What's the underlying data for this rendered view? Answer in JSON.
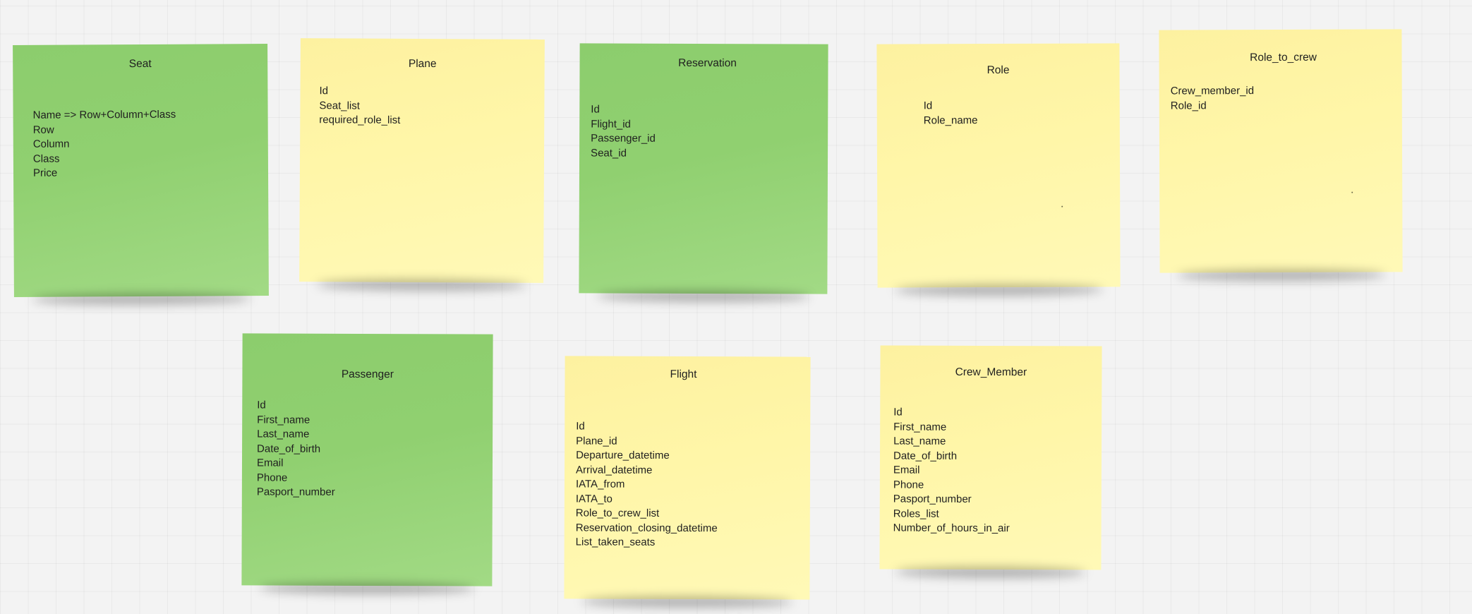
{
  "notes": [
    {
      "id": "seat",
      "title": "Seat",
      "color": "green",
      "fields": [
        "Name => Row+Column+Class",
        "Row",
        "Column",
        "Class",
        "Price"
      ]
    },
    {
      "id": "plane",
      "title": "Plane",
      "color": "yellow",
      "fields": [
        "Id",
        "Seat_list",
        "required_role_list"
      ]
    },
    {
      "id": "reservation",
      "title": "Reservation",
      "color": "green",
      "fields": [
        "Id",
        "Flight_id",
        "Passenger_id",
        "Seat_id"
      ]
    },
    {
      "id": "role",
      "title": "Role",
      "color": "yellow",
      "fields": [
        "Id",
        "Role_name"
      ]
    },
    {
      "id": "role-to-crew",
      "title": "Role_to_crew",
      "color": "yellow",
      "fields": [
        "Crew_member_id",
        "Role_id"
      ]
    },
    {
      "id": "passenger",
      "title": "Passenger",
      "color": "green",
      "fields": [
        "Id",
        "First_name",
        "Last_name",
        "Date_of_birth",
        "Email",
        "Phone",
        "Pasport_number"
      ]
    },
    {
      "id": "flight",
      "title": "Flight",
      "color": "yellow",
      "fields": [
        "Id",
        "Plane_id",
        "Departure_datetime",
        "Arrival_datetime",
        "IATA_from",
        "IATA_to",
        "Role_to_crew_list",
        "Reservation_closing_datetime",
        "List_taken_seats"
      ]
    },
    {
      "id": "crew-member",
      "title": "Crew_Member",
      "color": "yellow",
      "fields": [
        "Id",
        "First_name",
        "Last_name",
        "Date_of_birth",
        "Email",
        "Phone",
        "Pasport_number",
        "Roles_list",
        "Number_of_hours_in_air"
      ]
    }
  ]
}
